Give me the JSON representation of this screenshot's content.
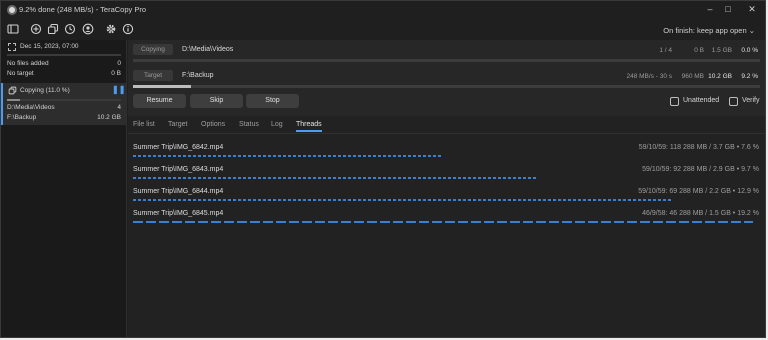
{
  "window": {
    "title": "9.2% done (248 MB/s) - TeraCopy Pro"
  },
  "toolbar": {
    "on_finish": "On finish: keep app open ⌄"
  },
  "sidebar": {
    "job1": {
      "date": "Dec 15, 2023, 07:00",
      "line1": "No files added",
      "line1_val": "0",
      "line2": "No target",
      "line2_val": "0 B"
    },
    "job2": {
      "status": "Copying (11.0 %)",
      "src": "D:\\Media\\Videos",
      "src_val": "4",
      "dst": "F:\\Backup",
      "dst_val": "10.2 GB",
      "progress": 0.11
    }
  },
  "main": {
    "source": {
      "label": "Copying",
      "path": "D:\\Media\\Videos",
      "files": "1 / 4",
      "copied": "0 B",
      "total": "1.5 GB",
      "percent": "0.0 %",
      "progress": 0.0
    },
    "target": {
      "label": "Target",
      "path": "F:\\Backup",
      "speed": "248 MB/s - 30 s",
      "copied": "960 MB",
      "total": "10.2 GB",
      "percent": "9.2 %",
      "progress": 0.092
    },
    "buttons": {
      "resume": "Resume",
      "skip": "Skip",
      "stop": "Stop"
    },
    "options": {
      "unattended": "Unattended",
      "verify": "Verify"
    },
    "tabs": [
      "File list",
      "Target",
      "Options",
      "Status",
      "Log",
      "Threads"
    ],
    "threads": [
      {
        "name": "Summer Trip\\IMG_6842.mp4",
        "stats": "59/10/59: 118   288 MB / 3.7 GB  •  7.6 %",
        "progress": 0.5
      },
      {
        "name": "Summer Trip\\IMG_6843.mp4",
        "stats": "59/10/59: 92   288 MB / 2.9 GB  •  9.7 %",
        "progress": 0.65
      },
      {
        "name": "Summer Trip\\IMG_6844.mp4",
        "stats": "59/10/59: 69   288 MB / 2.2 GB  •  12.9 %",
        "progress": 0.87
      },
      {
        "name": "Summer Trip\\IMG_6845.mp4",
        "stats": "46/9/58: 46   288 MB / 1.5 GB  •  19.2 %",
        "progress": 1.0
      }
    ]
  }
}
